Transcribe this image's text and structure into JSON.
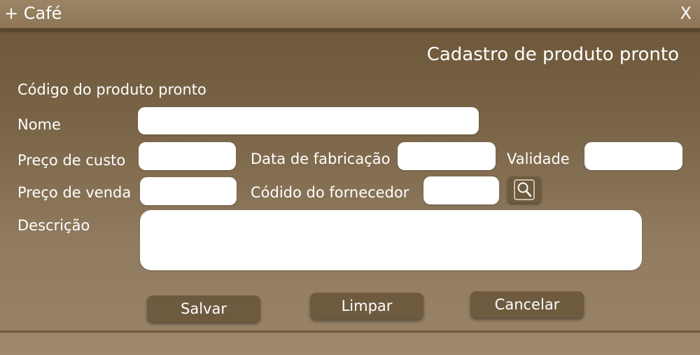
{
  "window": {
    "title": "+ Café",
    "close_label": "X"
  },
  "form": {
    "heading": "Cadastro de produto pronto",
    "labels": {
      "codigo": "Código do produto pronto",
      "nome": "Nome",
      "preco_custo": "Preço de custo",
      "data_fabricacao": "Data de fabricação",
      "validade": "Validade",
      "preco_venda": "Preço de venda",
      "codigo_fornecedor": "Códido do fornecedor",
      "descricao": "Descrição"
    },
    "fields": {
      "nome": "",
      "preco_custo": "",
      "data_fabricacao": "",
      "validade": "",
      "preco_venda": "",
      "codigo_fornecedor": "",
      "descricao": ""
    },
    "search_icon": "search-icon"
  },
  "buttons": {
    "salvar": "Salvar",
    "limpar": "Limpar",
    "cancelar": "Cancelar"
  },
  "colors": {
    "background": "#7a6446",
    "titlebar": "#8c7656",
    "button": "#6e5a3f",
    "field": "#ffffff",
    "text": "#ffffff"
  }
}
